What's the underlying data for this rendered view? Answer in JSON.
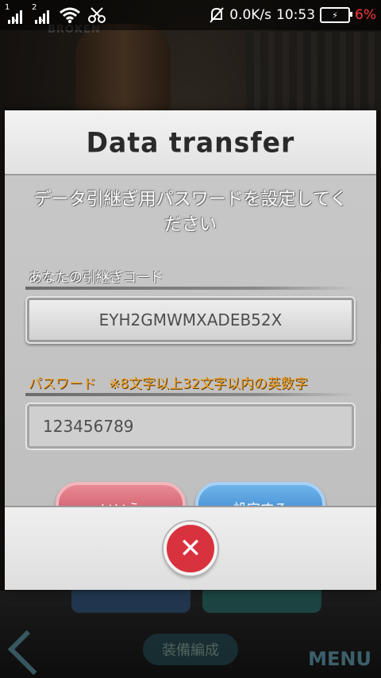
{
  "status_bar": {
    "sim1": "1",
    "sim2": "2",
    "speed": "0.0K/s",
    "time": "10:53",
    "battery_pct": "6%"
  },
  "background": {
    "faint_logo": "BROKEN",
    "equip_label": "装備編成",
    "menu_label": "MENU"
  },
  "dialog": {
    "title": "Data transfer",
    "subtitle": "データ引継ぎ用パスワードを設定してください",
    "code_label": "あなたの引継ぎコード",
    "code_value": "EYH2GMWMXADEB52X",
    "password_label": "パスワード",
    "password_note": "※8文字以上32文字以内の英数字",
    "password_value": "123456789",
    "no_button": "いいえ",
    "set_button": "設定する"
  },
  "icons": {
    "close": "close-icon",
    "wifi": "wifi-icon",
    "mute": "bell-off-icon"
  },
  "colors": {
    "accent_orange": "#f0a22a",
    "no_button": "#c14757",
    "set_button": "#2a78c6",
    "close_button": "#d9323f",
    "battery_low": "#ff3b3b"
  }
}
